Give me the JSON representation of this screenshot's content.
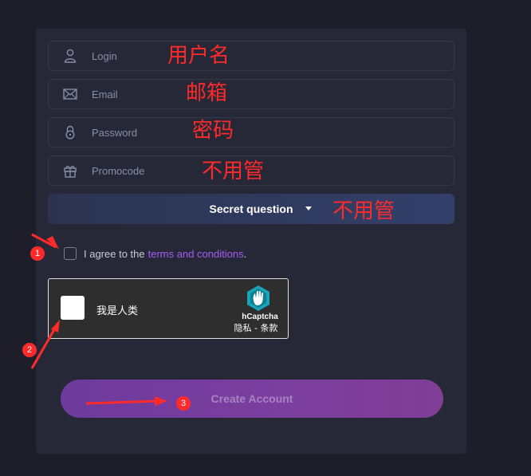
{
  "form": {
    "fields": [
      {
        "placeholder": "Login",
        "icon": "user-icon"
      },
      {
        "placeholder": "Email",
        "icon": "envelope-icon"
      },
      {
        "placeholder": "Password",
        "icon": "lock-icon"
      },
      {
        "placeholder": "Promocode",
        "icon": "gift-icon"
      }
    ],
    "secret_question_label": "Secret question",
    "agree_prefix": "I agree to the",
    "agree_link": "terms and conditions",
    "agree_suffix": ".",
    "create_button_label": "Create Account"
  },
  "captcha": {
    "label": "我是人类",
    "brand": "hCaptcha",
    "terms": "隐私 - 条款"
  },
  "annotations": {
    "login": "用户名",
    "email": "邮箱",
    "password": "密码",
    "promocode": "不用管",
    "secret": "不用管",
    "badges": [
      "1",
      "2",
      "3"
    ]
  },
  "colors": {
    "page_background": "#1d1e2a",
    "panel": "#262838",
    "link": "#a55cf3",
    "annotation": "#ff2a2a",
    "button": "#7b3f9f"
  }
}
